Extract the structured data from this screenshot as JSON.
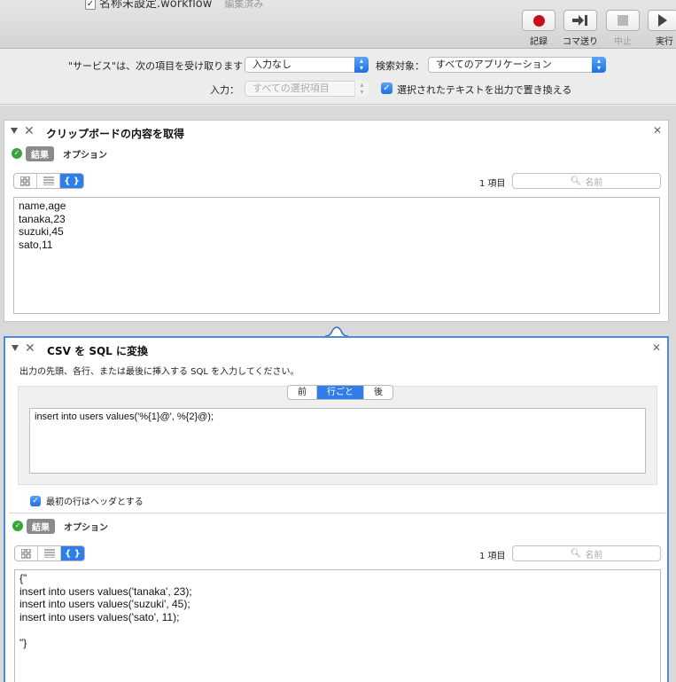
{
  "window": {
    "doc_title": "名称未設定.workflow",
    "doc_status": "編集済み"
  },
  "toolbar": {
    "record": "記録",
    "step": "コマ送り",
    "stop": "中止",
    "run": "実行"
  },
  "service": {
    "receives_label": "\"サービス\"は、次の項目を受け取ります：",
    "receives_value": "入力なし",
    "target_label": "検索対象：",
    "target_value": "すべてのアプリケーション",
    "input_label": "入力：",
    "input_value": "すべての選択項目",
    "replace_label": "選択されたテキストを出力で置き換える",
    "replace_checked": true
  },
  "action1": {
    "title": "クリップボードの内容を取得",
    "result_tab": "結果",
    "option_tab": "オプション",
    "view_icons": [
      "grid-icon",
      "list-icon",
      "code-icon"
    ],
    "count": "1 項目",
    "search_placeholder": "名前",
    "output_lines": [
      "name,age",
      "tanaka,23",
      "suzuki,45",
      "sato,11"
    ]
  },
  "action2": {
    "title": "CSV を SQL に変換",
    "description": "出力の先頭、各行、または最後に挿入する SQL を入力してください。",
    "segments": [
      "前",
      "行ごと",
      "後"
    ],
    "active_segment": "行ごと",
    "sql_template": "insert into users values('%{1}@', %{2}@);",
    "header_label": "最初の行はヘッダとする",
    "header_checked": true,
    "result_tab": "結果",
    "option_tab": "オプション",
    "count": "1 項目",
    "search_placeholder": "名前",
    "output_lines": [
      "{\"",
      "insert into users values('tanaka', 23);",
      "insert into users values('suzuki', 45);",
      "insert into users values('sato', 11);",
      "",
      "\"}"
    ]
  },
  "colors": {
    "accent": "#2f7de8",
    "record": "#c8101a",
    "ok": "#3aa43a"
  }
}
